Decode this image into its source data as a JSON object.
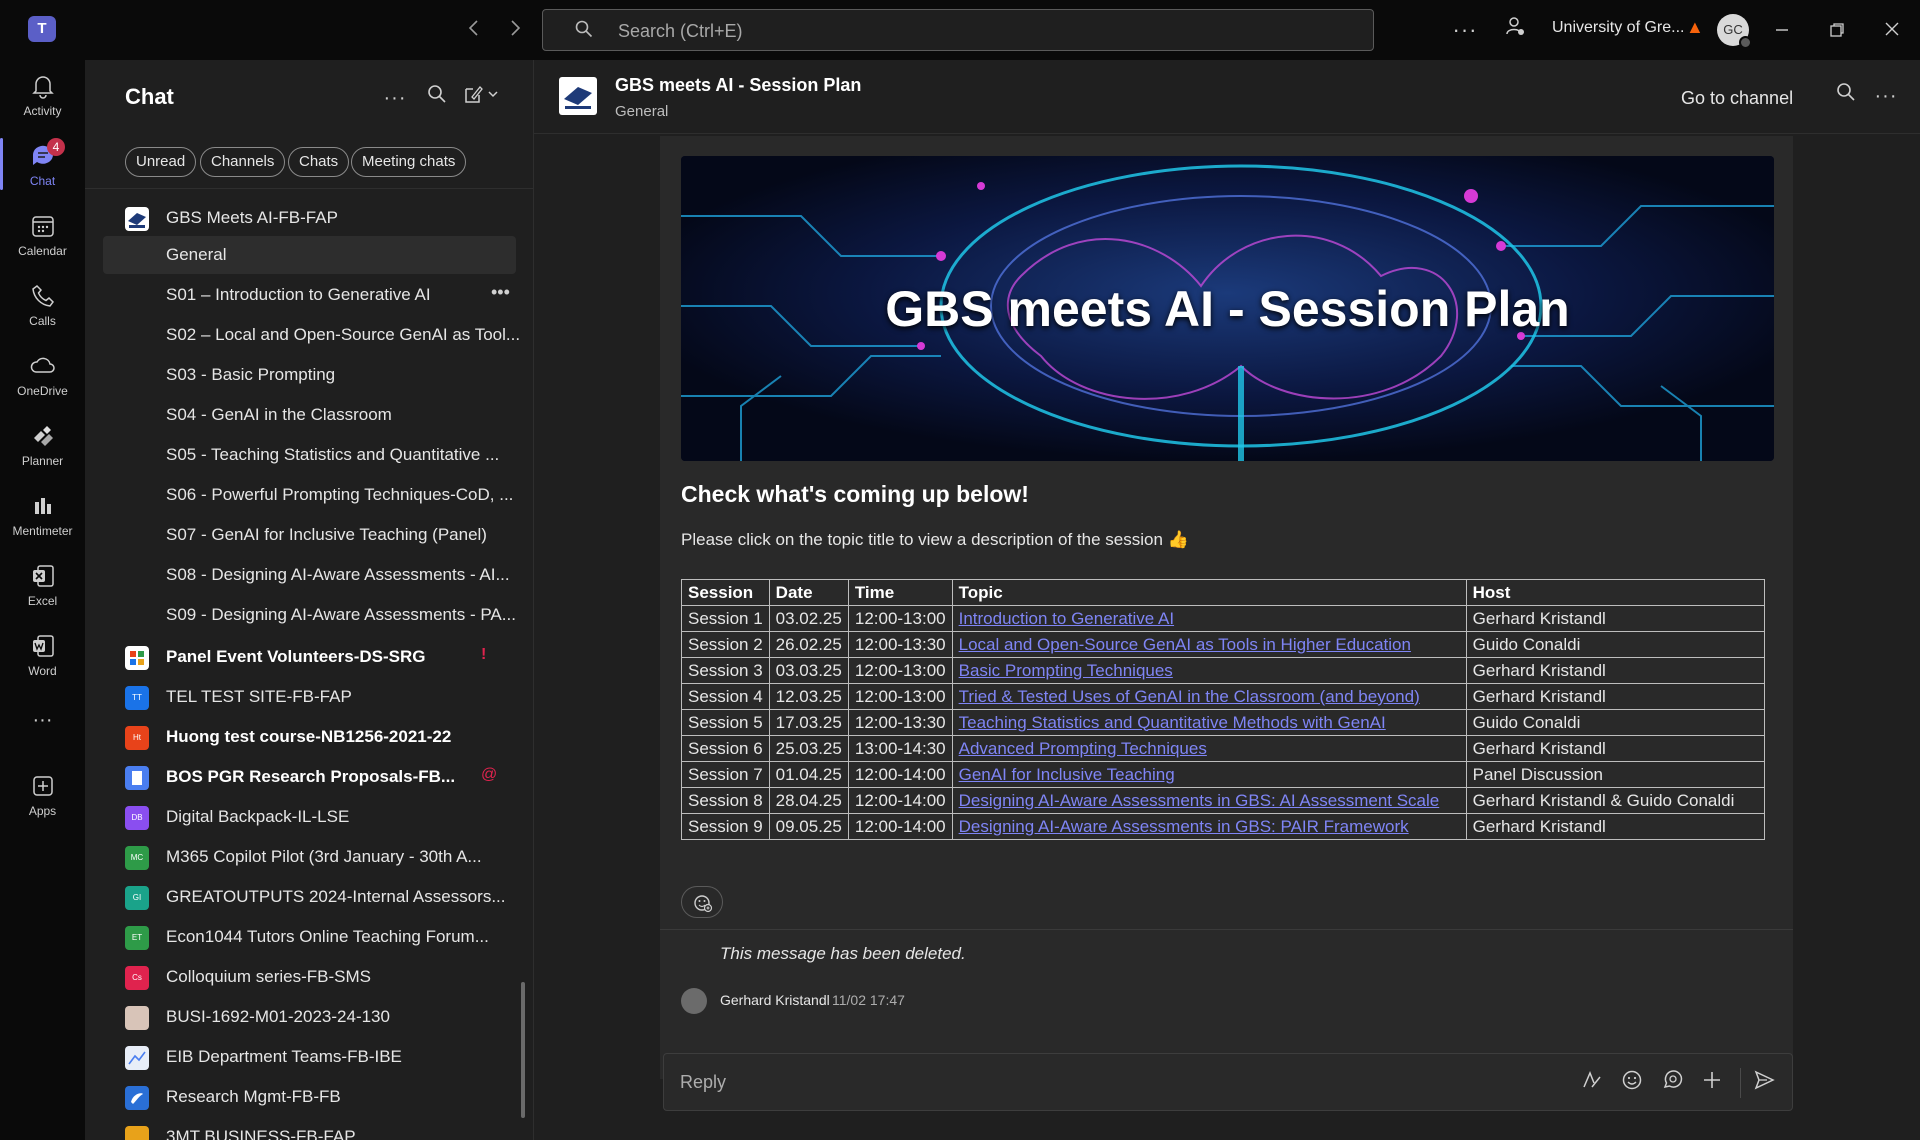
{
  "titlebar": {
    "logo": "T",
    "search_placeholder": "Search (Ctrl+E)",
    "org_name": "University of Gre...",
    "avatar_initials": "GC",
    "icons": [
      "back-icon",
      "forward-icon",
      "more-icon",
      "people-icon",
      "warning-icon",
      "minimize-icon",
      "restore-icon",
      "close-icon"
    ]
  },
  "rail": {
    "items": [
      {
        "label": "Activity",
        "icon": "bell-icon"
      },
      {
        "label": "Chat",
        "icon": "chat-icon",
        "badge": "4",
        "active": true
      },
      {
        "label": "Calendar",
        "icon": "calendar-icon"
      },
      {
        "label": "Calls",
        "icon": "phone-icon"
      },
      {
        "label": "OneDrive",
        "icon": "cloud-icon"
      },
      {
        "label": "Planner",
        "icon": "planner-icon"
      },
      {
        "label": "Mentimeter",
        "icon": "mentimeter-icon"
      },
      {
        "label": "Excel",
        "icon": "excel-icon"
      },
      {
        "label": "Word",
        "icon": "word-icon"
      },
      {
        "label": "Apps",
        "icon": "apps-icon"
      }
    ]
  },
  "chatpane": {
    "title": "Chat",
    "filters": [
      "Unread",
      "Channels",
      "Chats",
      "Meeting chats"
    ],
    "team_name": "GBS Meets AI-FB-FAP",
    "channels": [
      "General",
      "S01 – Introduction to Generative AI",
      "S02 – Local and Open-Source GenAI as Tool...",
      "S03 - Basic Prompting",
      "S04 - GenAI in the Classroom",
      "S05 - Teaching Statistics and Quantitative ...",
      "S06 - Powerful Prompting Techniques-CoD, ...",
      "S07 - GenAI for Inclusive Teaching (Panel)",
      "S08 - Designing AI-Aware Assessments - AI...",
      "S09 - Designing AI-Aware Assessments - PA..."
    ],
    "teams": [
      {
        "name": "Panel Event Volunteers-DS-SRG",
        "bold": true,
        "color": "#ffffff",
        "abbr": "",
        "mark": "!"
      },
      {
        "name": "TEL TEST SITE-FB-FAP",
        "bold": false,
        "color": "#1a73e8",
        "abbr": "TT",
        "mark": ""
      },
      {
        "name": "Huong test course-NB1256-2021-22",
        "bold": true,
        "color": "#e8431a",
        "abbr": "Ht",
        "mark": ""
      },
      {
        "name": "BOS PGR Research Proposals-FB...",
        "bold": true,
        "color": "#4a7ef0",
        "abbr": "",
        "mark": "@"
      },
      {
        "name": "Digital Backpack-IL-LSE",
        "bold": false,
        "color": "#8a4ef0",
        "abbr": "DB",
        "mark": ""
      },
      {
        "name": "M365 Copilot Pilot (3rd January - 30th A...",
        "bold": false,
        "color": "#2e9b48",
        "abbr": "MC",
        "mark": ""
      },
      {
        "name": "GREATOUTPUTS 2024-Internal Assessors...",
        "bold": false,
        "color": "#1aa38a",
        "abbr": "GI",
        "mark": ""
      },
      {
        "name": "Econ1044 Tutors Online Teaching Forum...",
        "bold": false,
        "color": "#2e9b48",
        "abbr": "ET",
        "mark": ""
      },
      {
        "name": "Colloquium series-FB-SMS",
        "bold": false,
        "color": "#e0234e",
        "abbr": "Cs",
        "mark": ""
      },
      {
        "name": "BUSI-1692-M01-2023-24-130",
        "bold": false,
        "color": "#d8c4b8",
        "abbr": "",
        "mark": ""
      },
      {
        "name": "EIB Department Teams-FB-IBE",
        "bold": false,
        "color": "#e8eef8",
        "abbr": "",
        "mark": ""
      },
      {
        "name": "Research Mgmt-FB-FB",
        "bold": false,
        "color": "#2a6fd6",
        "abbr": "",
        "mark": ""
      },
      {
        "name": "3MT BUSINESS-FB-FAP",
        "bold": false,
        "color": "#e8a21a",
        "abbr": "",
        "mark": ""
      }
    ]
  },
  "channel": {
    "title": "GBS meets AI - Session Plan",
    "subtitle": "General",
    "goto_label": "Go to channel"
  },
  "post": {
    "banner_title": "GBS meets AI - Session Plan",
    "heading": "Check what's coming up below!",
    "intro": "Please click on the topic title to view a description of the session 👍",
    "table_headers": [
      "Session",
      "Date",
      "Time",
      "Topic",
      "Host"
    ],
    "table_rows": [
      [
        "Session 1",
        "03.02.25",
        "12:00-13:00",
        "Introduction to Generative AI",
        "Gerhard Kristandl"
      ],
      [
        "Session 2",
        "26.02.25",
        "12:00-13:30",
        "Local and Open-Source GenAI as Tools in Higher Education",
        "Guido Conaldi"
      ],
      [
        "Session 3",
        "03.03.25",
        "12:00-13:00",
        "Basic Prompting Techniques",
        "Gerhard Kristandl"
      ],
      [
        "Session 4",
        "12.03.25",
        "12:00-13:00",
        "Tried & Tested Uses of GenAI in the Classroom (and beyond)",
        "Gerhard Kristandl"
      ],
      [
        "Session 5",
        "17.03.25",
        "12:00-13:30",
        "Teaching Statistics and Quantitative Methods with GenAI",
        "Guido Conaldi"
      ],
      [
        "Session 6",
        "25.03.25",
        "13:00-14:30",
        "Advanced Prompting Techniques",
        "Gerhard Kristandl"
      ],
      [
        "Session 7",
        "01.04.25",
        "12:00-14:00",
        "GenAI for Inclusive Teaching",
        "Panel Discussion"
      ],
      [
        "Session 8",
        "28.04.25",
        "12:00-14:00",
        "Designing AI-Aware Assessments in GBS: AI Assessment Scale",
        "Gerhard Kristandl & Guido Conaldi"
      ],
      [
        "Session 9",
        "09.05.25",
        "12:00-14:00",
        "Designing AI-Aware Assessments in GBS: PAIR Framework",
        "Gerhard Kristandl"
      ]
    ],
    "deleted_text": "This message has been deleted.",
    "reply_author": "Gerhard Kristandl",
    "reply_time": "11/02 17:47"
  },
  "replybox": {
    "placeholder": "Reply",
    "icons": [
      "format-icon",
      "emoji-icon",
      "loop-icon",
      "attach-icon",
      "send-icon"
    ]
  },
  "colors": {
    "accent": "#7f85f5",
    "background": "#1f1f1f",
    "rail": "#0a0a0a",
    "badge": "#c4314b"
  }
}
